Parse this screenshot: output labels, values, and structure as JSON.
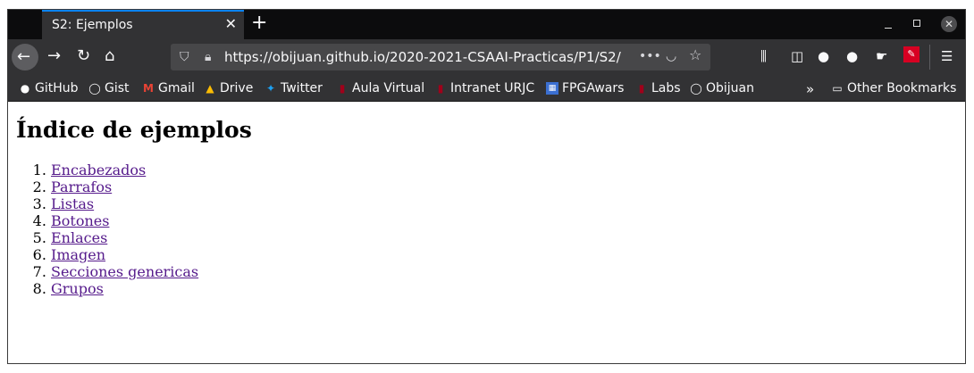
{
  "tab": {
    "title": "S2: Ejemplos"
  },
  "url": "https://obijuan.github.io/2020-2021-CSAAI-Practicas/P1/S2/",
  "bookmarks": [
    {
      "label": "GitHub"
    },
    {
      "label": "Gist"
    },
    {
      "label": "Gmail"
    },
    {
      "label": "Drive"
    },
    {
      "label": "Twitter"
    },
    {
      "label": "Aula Virtual"
    },
    {
      "label": "Intranet URJC"
    },
    {
      "label": "FPGAwars"
    },
    {
      "label": "Labs"
    },
    {
      "label": "Obijuan"
    }
  ],
  "other_bookmarks": "Other Bookmarks",
  "page": {
    "heading": "Índice de ejemplos",
    "items": [
      "Encabezados",
      "Parrafos",
      "Listas",
      "Botones",
      "Enlaces",
      "Imagen",
      "Secciones genericas",
      "Grupos"
    ]
  },
  "colors": {
    "accent": "#0a84ff",
    "link_visited": "#551a8b",
    "chrome_bg": "#323234"
  }
}
